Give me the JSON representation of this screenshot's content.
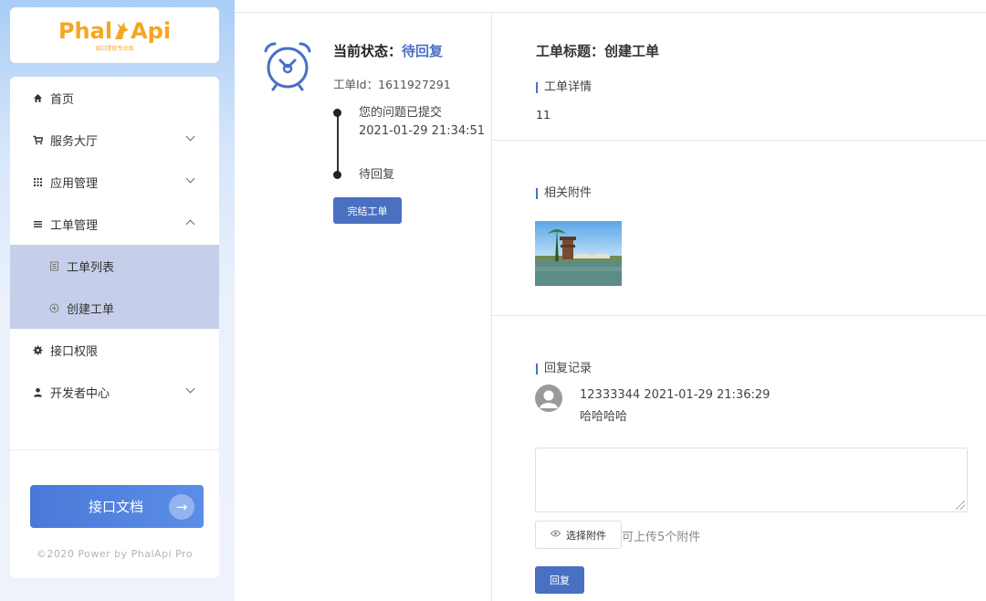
{
  "brand": {
    "logo_text_left": "Phal",
    "logo_text_right": "Api",
    "logo_sub": "接口提供专业级",
    "accent_color": "#f5a623"
  },
  "sidebar": {
    "items": [
      {
        "label": "首页",
        "icon": "home-icon"
      },
      {
        "label": "服务大厅",
        "icon": "cart-icon",
        "expandable": true,
        "expanded": false
      },
      {
        "label": "应用管理",
        "icon": "grid-icon",
        "expandable": true,
        "expanded": false
      },
      {
        "label": "工单管理",
        "icon": "list-icon",
        "expandable": true,
        "expanded": true
      },
      {
        "label": "接口权限",
        "icon": "gear-icon"
      },
      {
        "label": "开发者中心",
        "icon": "user-icon",
        "expandable": true,
        "expanded": false
      }
    ],
    "subitems": [
      {
        "label": "工单列表",
        "icon": "document-icon"
      },
      {
        "label": "创建工单",
        "icon": "plus-circle-icon"
      }
    ],
    "doc_button": "接口文档",
    "copyright": "©2020 Power by PhalApi Pro"
  },
  "ticket": {
    "status_label": "当前状态：",
    "status_value": "待回复",
    "id_label": "工单Id：",
    "id_value": "1611927291",
    "timeline": [
      {
        "text": "您的问题已提交",
        "time": "2021-01-29 21:34:51"
      },
      {
        "text": "待回复",
        "time": ""
      }
    ],
    "finish_button": "完结工单",
    "status_color": "#4a70c2"
  },
  "detail": {
    "title_label": "工单标题：",
    "title_value": "创建工单",
    "section_detail": "工单详情",
    "detail_text": "11",
    "section_attachments": "相关附件",
    "section_replies": "回复记录"
  },
  "replies": [
    {
      "user": "12333344",
      "time": "2021-01-29 21:36:29",
      "content": "哈哈哈哈"
    }
  ],
  "reply_form": {
    "placeholder": "",
    "choose_attachment": "选择附件",
    "upload_hint": "可上传5个附件",
    "submit_button": "回复"
  }
}
